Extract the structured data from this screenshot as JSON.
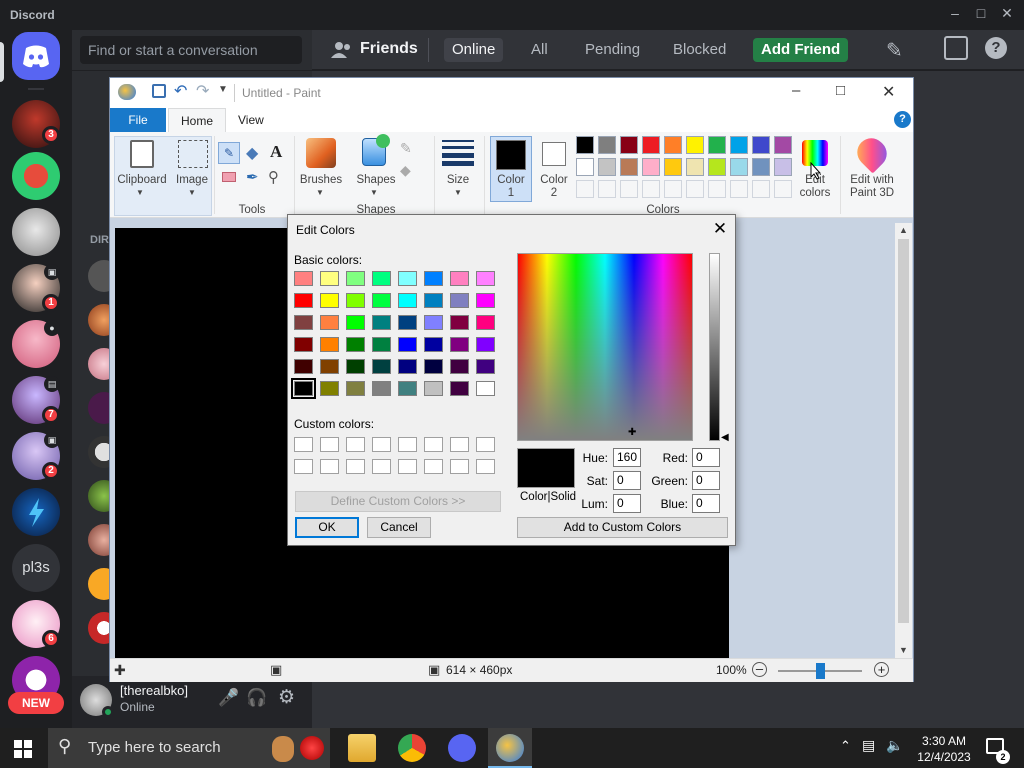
{
  "discord": {
    "brand": "Discord",
    "search_placeholder": "Find or start a conversation",
    "header": {
      "friends_label": "Friends",
      "tabs": [
        "Online",
        "All",
        "Pending",
        "Blocked"
      ],
      "add_friend_label": "Add Friend"
    },
    "dm_heading": "DIR",
    "server_badges": [
      "3",
      "1",
      "7",
      "2",
      "6"
    ],
    "text_server": "pl3s",
    "new_badge": "NEW",
    "user": {
      "name": "[therealbko]",
      "status": "Online"
    },
    "accent": "#5865f2",
    "add_friend_color": "#248046"
  },
  "paint": {
    "title": "Untitled - Paint",
    "tabs": {
      "file": "File",
      "home": "Home",
      "view": "View"
    },
    "ribbon": {
      "clipboard": "Clipboard",
      "image": "Image",
      "tools": "Tools",
      "brushes": "Brushes",
      "shapes": "Shapes",
      "size": "Size",
      "color1_line1": "Color",
      "color1_line2": "1",
      "color2_line1": "Color",
      "color2_line2": "2",
      "colors_group": "Colors",
      "edit_colors_line1": "Edit",
      "edit_colors_line2": "colors",
      "paint3d_line1": "Edit with",
      "paint3d_line2": "Paint 3D"
    },
    "palette_row1": [
      "#000000",
      "#7f7f7f",
      "#880015",
      "#ed1c24",
      "#ff7f27",
      "#fff200",
      "#22b14c",
      "#00a2e8",
      "#3f48cc",
      "#a349a4"
    ],
    "palette_row2": [
      "#ffffff",
      "#c3c3c3",
      "#b97a57",
      "#ffaec9",
      "#ffc90e",
      "#efe4b0",
      "#b5e61d",
      "#99d9ea",
      "#7092be",
      "#c8bfe7"
    ],
    "status": {
      "dimensions": "614 × 460px",
      "zoom": "100%"
    }
  },
  "edit_colors": {
    "title": "Edit Colors",
    "basic_label": "Basic colors:",
    "custom_label": "Custom colors:",
    "basic_colors": [
      [
        "#ff8080",
        "#ffff80",
        "#80ff80",
        "#00ff80",
        "#80ffff",
        "#0080ff",
        "#ff80c0",
        "#ff80ff"
      ],
      [
        "#ff0000",
        "#ffff00",
        "#80ff00",
        "#00ff40",
        "#00ffff",
        "#0080c0",
        "#8080c0",
        "#ff00ff"
      ],
      [
        "#804040",
        "#ff8040",
        "#00ff00",
        "#008080",
        "#004080",
        "#8080ff",
        "#800040",
        "#ff0080"
      ],
      [
        "#800000",
        "#ff8000",
        "#008000",
        "#008040",
        "#0000ff",
        "#0000a0",
        "#800080",
        "#8000ff"
      ],
      [
        "#400000",
        "#804000",
        "#004000",
        "#004040",
        "#000080",
        "#000040",
        "#400040",
        "#400080"
      ],
      [
        "#000000",
        "#808000",
        "#808040",
        "#808080",
        "#408080",
        "#c0c0c0",
        "#400040",
        "#ffffff"
      ]
    ],
    "define_custom_label": "Define Custom Colors >>",
    "ok_label": "OK",
    "cancel_label": "Cancel",
    "colorsolid_label": "Color|Solid",
    "hue_label": "Hue:",
    "hue": "160",
    "sat_label": "Sat:",
    "sat": "0",
    "lum_label": "Lum:",
    "lum": "0",
    "red_label": "Red:",
    "red": "0",
    "green_label": "Green:",
    "green": "0",
    "blue_label": "Blue:",
    "blue": "0",
    "add_custom_label": "Add to Custom Colors"
  },
  "taskbar": {
    "search_placeholder": "Type here to search",
    "time": "3:30 AM",
    "date": "12/4/2023"
  }
}
